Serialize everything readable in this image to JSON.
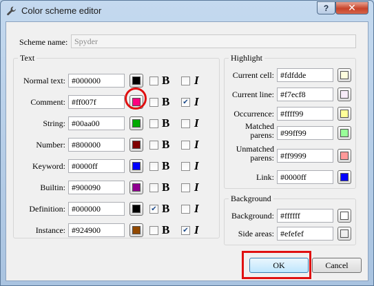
{
  "window": {
    "title": "Color scheme editor",
    "help_label": "?",
    "close_label": "✕",
    "icon": "wrench-icon"
  },
  "scheme": {
    "label": "Scheme name:",
    "value": "Spyder"
  },
  "text_group": {
    "title": "Text",
    "rows": [
      {
        "label": "Normal text:",
        "value": "#000000",
        "color": "#000000",
        "bold": false,
        "italic": false
      },
      {
        "label": "Comment:",
        "value": "#ff007f",
        "color": "#ff007f",
        "bold": false,
        "italic": true
      },
      {
        "label": "String:",
        "value": "#00aa00",
        "color": "#00aa00",
        "bold": false,
        "italic": false
      },
      {
        "label": "Number:",
        "value": "#800000",
        "color": "#800000",
        "bold": false,
        "italic": false
      },
      {
        "label": "Keyword:",
        "value": "#0000ff",
        "color": "#0000ff",
        "bold": false,
        "italic": false
      },
      {
        "label": "Builtin:",
        "value": "#900090",
        "color": "#900090",
        "bold": false,
        "italic": false
      },
      {
        "label": "Definition:",
        "value": "#000000",
        "color": "#000000",
        "bold": true,
        "italic": false
      },
      {
        "label": "Instance:",
        "value": "#924900",
        "color": "#924900",
        "bold": false,
        "italic": true
      }
    ],
    "bold_label": "B",
    "italic_label": "I"
  },
  "highlight_group": {
    "title": "Highlight",
    "rows": [
      {
        "label": "Current cell:",
        "value": "#fdfdde",
        "color": "#fdfdde"
      },
      {
        "label": "Current line:",
        "value": "#f7ecf8",
        "color": "#f7ecf8"
      },
      {
        "label": "Occurrence:",
        "value": "#ffff99",
        "color": "#ffff99"
      },
      {
        "label": "Matched parens:",
        "value": "#99ff99",
        "color": "#99ff99"
      },
      {
        "label": "Unmatched parens:",
        "value": "#ff9999",
        "color": "#ff9999"
      },
      {
        "label": "Link:",
        "value": "#0000ff",
        "color": "#0000ff"
      }
    ]
  },
  "background_group": {
    "title": "Background",
    "rows": [
      {
        "label": "Background:",
        "value": "#ffffff",
        "color": "#ffffff"
      },
      {
        "label": "Side areas:",
        "value": "#efefef",
        "color": "#efefef"
      }
    ]
  },
  "buttons": {
    "ok": "OK",
    "cancel": "Cancel"
  },
  "annotations": {
    "highlight_color": "#e01010"
  }
}
